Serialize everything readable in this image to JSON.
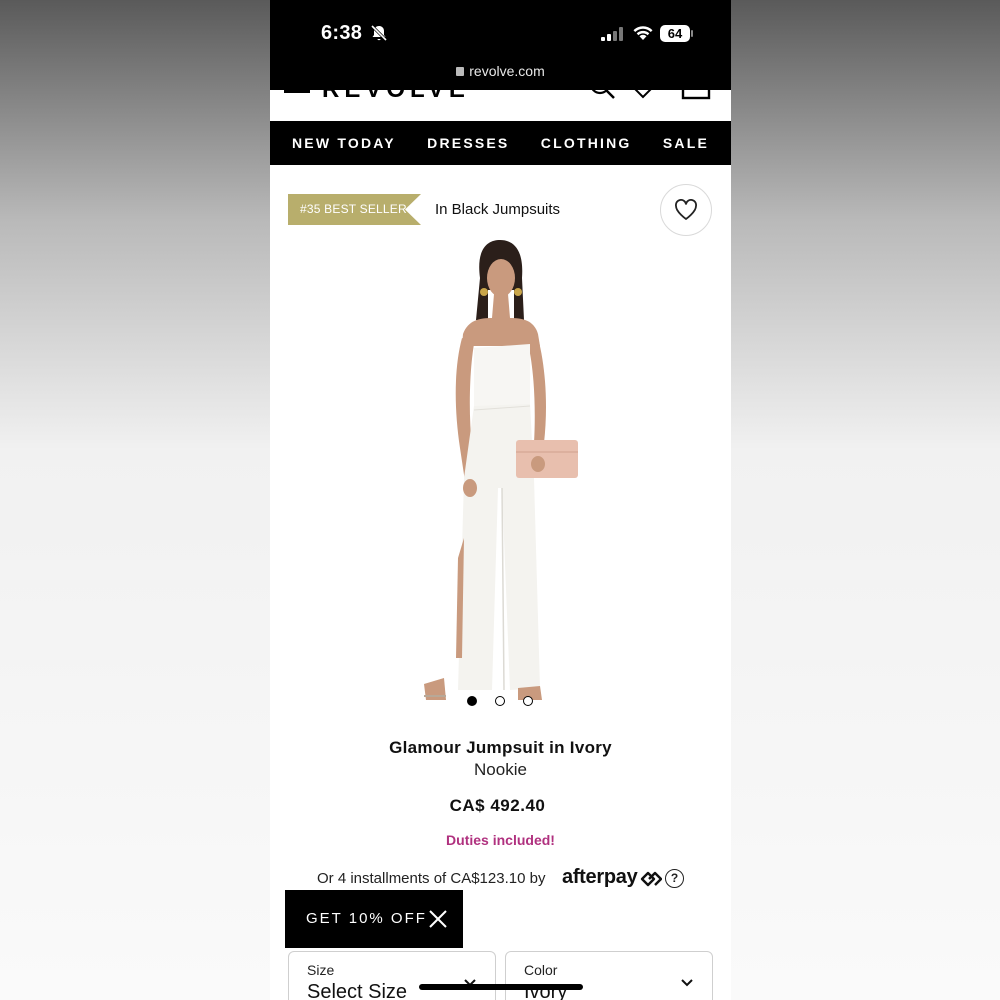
{
  "status_bar": {
    "time": "6:38",
    "battery": "64"
  },
  "browser": {
    "url": "revolve.com"
  },
  "header": {
    "logo": "REVOLVE"
  },
  "nav": {
    "items": [
      {
        "label": "NEW TODAY"
      },
      {
        "label": "DRESSES"
      },
      {
        "label": "CLOTHING"
      },
      {
        "label": "SALE"
      }
    ]
  },
  "product": {
    "badge": "#35 BEST SELLER",
    "badge_context": "In Black Jumpsuits",
    "name": "Glamour Jumpsuit in Ivory",
    "brand": "Nookie",
    "price": "CA$ 492.40",
    "duties": "Duties included!",
    "installments": "Or 4 installments of CA$123.10 by",
    "afterpay": "afterpay",
    "help": "?",
    "image_count": 3,
    "active_image": 1
  },
  "promo": {
    "label": "GET 10% OFF"
  },
  "selectors": {
    "size": {
      "label": "Size",
      "value": "Select Size"
    },
    "color": {
      "label": "Color",
      "value": "Ivory"
    }
  },
  "colors": {
    "badge": "#b8ae6c",
    "duties": "#b0317f",
    "nav_bg": "#000000"
  }
}
